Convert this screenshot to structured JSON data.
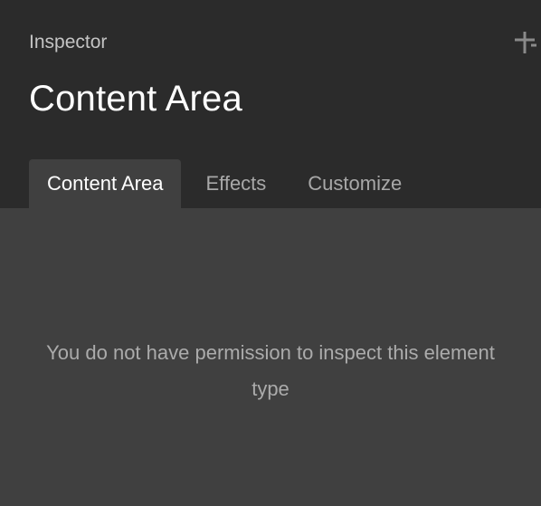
{
  "inspector": {
    "label": "Inspector",
    "title": "Content Area",
    "pin_icon": "pin-icon"
  },
  "tabs": [
    {
      "label": "Content Area",
      "active": true
    },
    {
      "label": "Effects",
      "active": false
    },
    {
      "label": "Customize",
      "active": false
    }
  ],
  "content": {
    "message": "You do not have permission to inspect this element type"
  },
  "colors": {
    "header_bg": "#2b2b2b",
    "body_bg": "#404040",
    "active_tab_text": "#ffffff",
    "inactive_tab_text": "#a8a8a8",
    "message_text": "#ababab"
  }
}
